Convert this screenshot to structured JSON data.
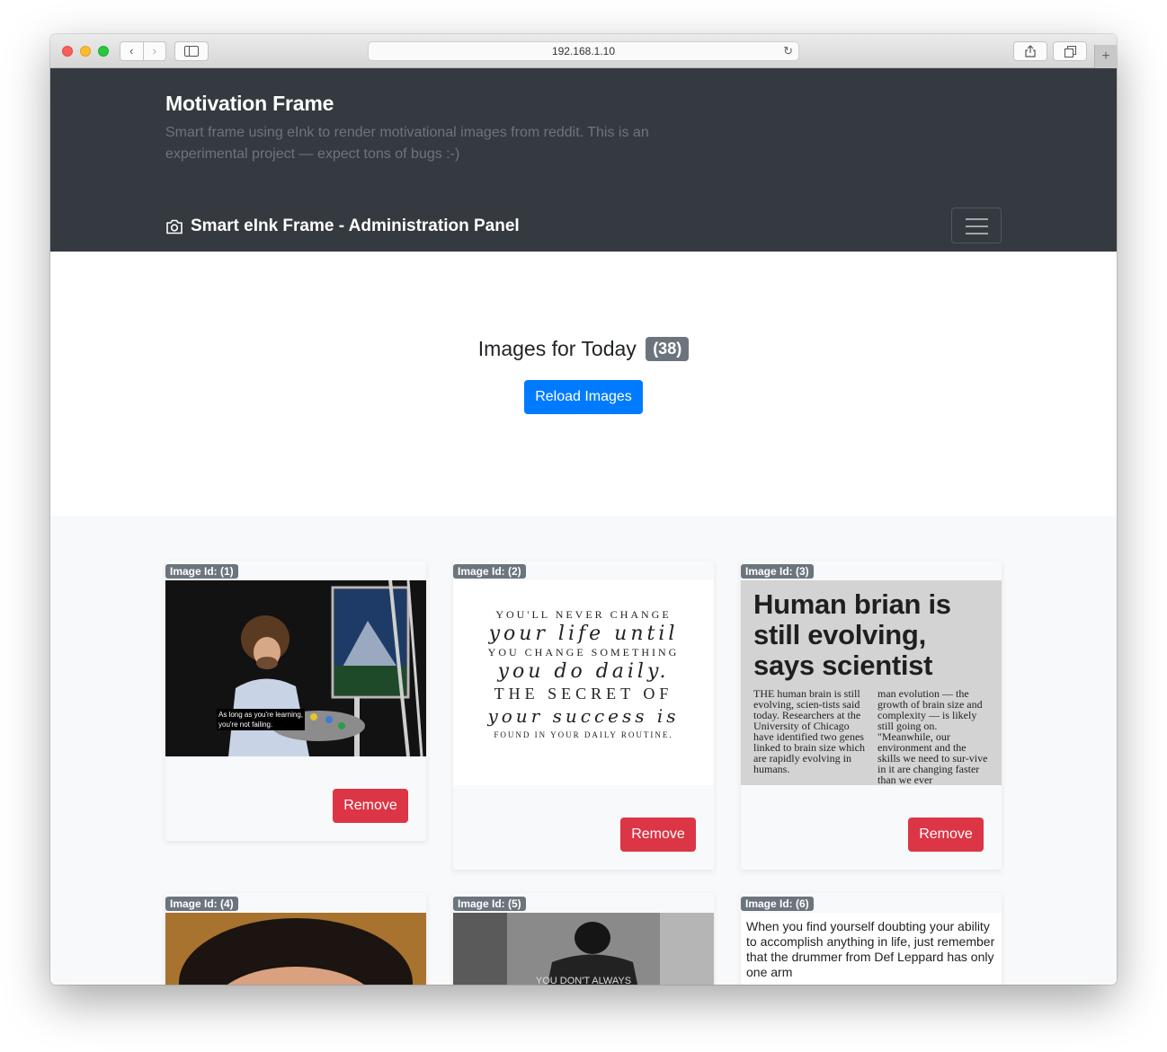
{
  "browser": {
    "url": "192.168.1.10"
  },
  "header": {
    "title": "Motivation Frame",
    "description": "Smart frame using eInk to render motivational images from reddit. This is an experimental project — expect tons of bugs :-)",
    "brand": "Smart eInk Frame - Administration Panel"
  },
  "jumbotron": {
    "title": "Images for Today",
    "count": "(38)",
    "reload_label": "Reload Images"
  },
  "cards": [
    {
      "label": "Image Id: (1)",
      "caption_line1": "As long as you're learning,",
      "caption_line2": "you're not failing.",
      "remove_label": "Remove"
    },
    {
      "label": "Image Id: (2)",
      "lines": [
        "YOU'LL NEVER CHANGE",
        "your life until",
        "YOU CHANGE SOMETHING",
        "you do daily.",
        "THE SECRET OF",
        "your success is",
        "FOUND IN YOUR DAILY ROUTINE."
      ],
      "remove_label": "Remove"
    },
    {
      "label": "Image Id: (3)",
      "headline": "Human brian is still evolving, says scientist",
      "col1": "THE human brain is still evolving, scien-tists said today. Researchers at the University of Chicago have identified two genes linked to brain size which are rapidly evolving in humans.",
      "col2": "man evolution — the growth of brain size and complexity — is likely still going on. \"Meanwhile, our environment and the skills we need to sur-vive in it are changing faster than we ever",
      "remove_label": "Remove"
    },
    {
      "label": "Image Id: (4)"
    },
    {
      "label": "Image Id: (5)",
      "shirt_text": "YOU DON'T ALWAYS"
    },
    {
      "label": "Image Id: (6)",
      "text": "When you find yourself doubting your ability to accomplish anything in life, just remember that the drummer from Def Leppard has only one arm"
    }
  ]
}
